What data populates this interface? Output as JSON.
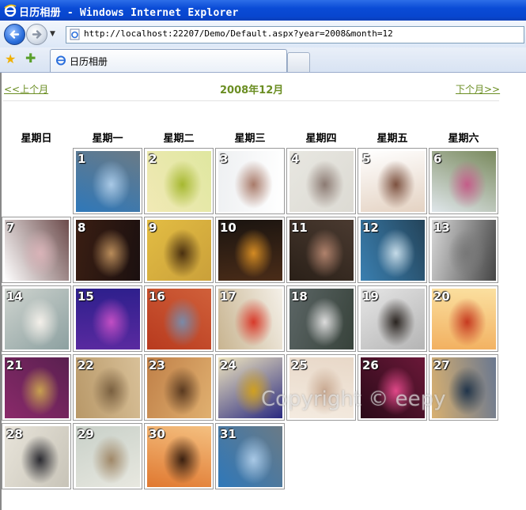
{
  "window": {
    "title": "日历相册 - Windows Internet Explorer"
  },
  "address": {
    "url": "http://localhost:22207/Demo/Default.aspx?year=2008&month=12"
  },
  "tab": {
    "label": "日历相册"
  },
  "calendar": {
    "prev_label": "<<上个月",
    "month_title": "2008年12月",
    "next_label": "下个月>>",
    "weekdays": [
      "星期日",
      "星期一",
      "星期二",
      "星期三",
      "星期四",
      "星期五",
      "星期六"
    ],
    "days": [
      {
        "n": "1",
        "c": [
          "#2f78b9",
          "#a9c9e6",
          "#6a7a86"
        ]
      },
      {
        "n": "2",
        "c": [
          "#f1e9b5",
          "#a6b830",
          "#dfe7a0"
        ]
      },
      {
        "n": "3",
        "c": [
          "#eef0f2",
          "#a97b6a",
          "#ffffff"
        ]
      },
      {
        "n": "4",
        "c": [
          "#e8e7e1",
          "#8c7b73",
          "#dcdad3"
        ]
      },
      {
        "n": "5",
        "c": [
          "#ffffff",
          "#7d5240",
          "#e4d2c2"
        ]
      },
      {
        "n": "6",
        "c": [
          "#dfe6ea",
          "#c45d89",
          "#7a8a5e"
        ]
      },
      {
        "n": "7",
        "c": [
          "#ffffff",
          "#d9b3b8",
          "#6c4b4b"
        ]
      },
      {
        "n": "8",
        "c": [
          "#3a1e12",
          "#b98c5a",
          "#1b1010"
        ]
      },
      {
        "n": "9",
        "c": [
          "#e3bd43",
          "#4a3010",
          "#caa03a"
        ]
      },
      {
        "n": "10",
        "c": [
          "#1a1410",
          "#d48b23",
          "#4a2c18"
        ]
      },
      {
        "n": "11",
        "c": [
          "#2a2018",
          "#b0826c",
          "#4a3a30"
        ]
      },
      {
        "n": "12",
        "c": [
          "#3a7fb0",
          "#c5dbe8",
          "#24445a"
        ]
      },
      {
        "n": "13",
        "c": [
          "#d8d8d8",
          "#777777",
          "#444444"
        ]
      },
      {
        "n": "14",
        "c": [
          "#cfd4cf",
          "#f4f0ea",
          "#8ca0a0"
        ]
      },
      {
        "n": "15",
        "c": [
          "#2d1f8c",
          "#c24ec4",
          "#5a2aa0"
        ]
      },
      {
        "n": "16",
        "c": [
          "#b83a1e",
          "#7a8aa8",
          "#d0603a"
        ]
      },
      {
        "n": "17",
        "c": [
          "#c8b490",
          "#d83a2a",
          "#f4f0e8"
        ]
      },
      {
        "n": "18",
        "c": [
          "#5c6666",
          "#dcdcdc",
          "#37423a"
        ]
      },
      {
        "n": "19",
        "c": [
          "#e6e6e6",
          "#2a2420",
          "#b4b4b4"
        ]
      },
      {
        "n": "20",
        "c": [
          "#f2b060",
          "#c63a20",
          "#fbe0a0"
        ]
      },
      {
        "n": "21",
        "c": [
          "#8a2a6a",
          "#c8a050",
          "#5a2050"
        ]
      },
      {
        "n": "22",
        "c": [
          "#b89868",
          "#7a6040",
          "#d8c098"
        ]
      },
      {
        "n": "23",
        "c": [
          "#c08048",
          "#5a3a20",
          "#e0b070"
        ]
      },
      {
        "n": "24",
        "c": [
          "#f0e6c0",
          "#d0a020",
          "#2a2a80"
        ]
      },
      {
        "n": "25",
        "c": [
          "#f4ebe0",
          "#c8a890",
          "#e8d8c8"
        ]
      },
      {
        "n": "26",
        "c": [
          "#2a0a18",
          "#e04888",
          "#6a1838"
        ]
      },
      {
        "n": "27",
        "c": [
          "#d8b070",
          "#20344a",
          "#6a7890"
        ]
      },
      {
        "n": "28",
        "c": [
          "#e8e4da",
          "#2a2a30",
          "#c8c4b8"
        ]
      },
      {
        "n": "29",
        "c": [
          "#c8d0c8",
          "#a08868",
          "#e8e8e0"
        ]
      },
      {
        "n": "30",
        "c": [
          "#e07830",
          "#3a2010",
          "#f4c080"
        ]
      },
      {
        "n": "31",
        "c": [
          "#2f78b9",
          "#a9c9e6",
          "#6a7a86"
        ]
      }
    ]
  },
  "watermark": "Copyright © eepy"
}
